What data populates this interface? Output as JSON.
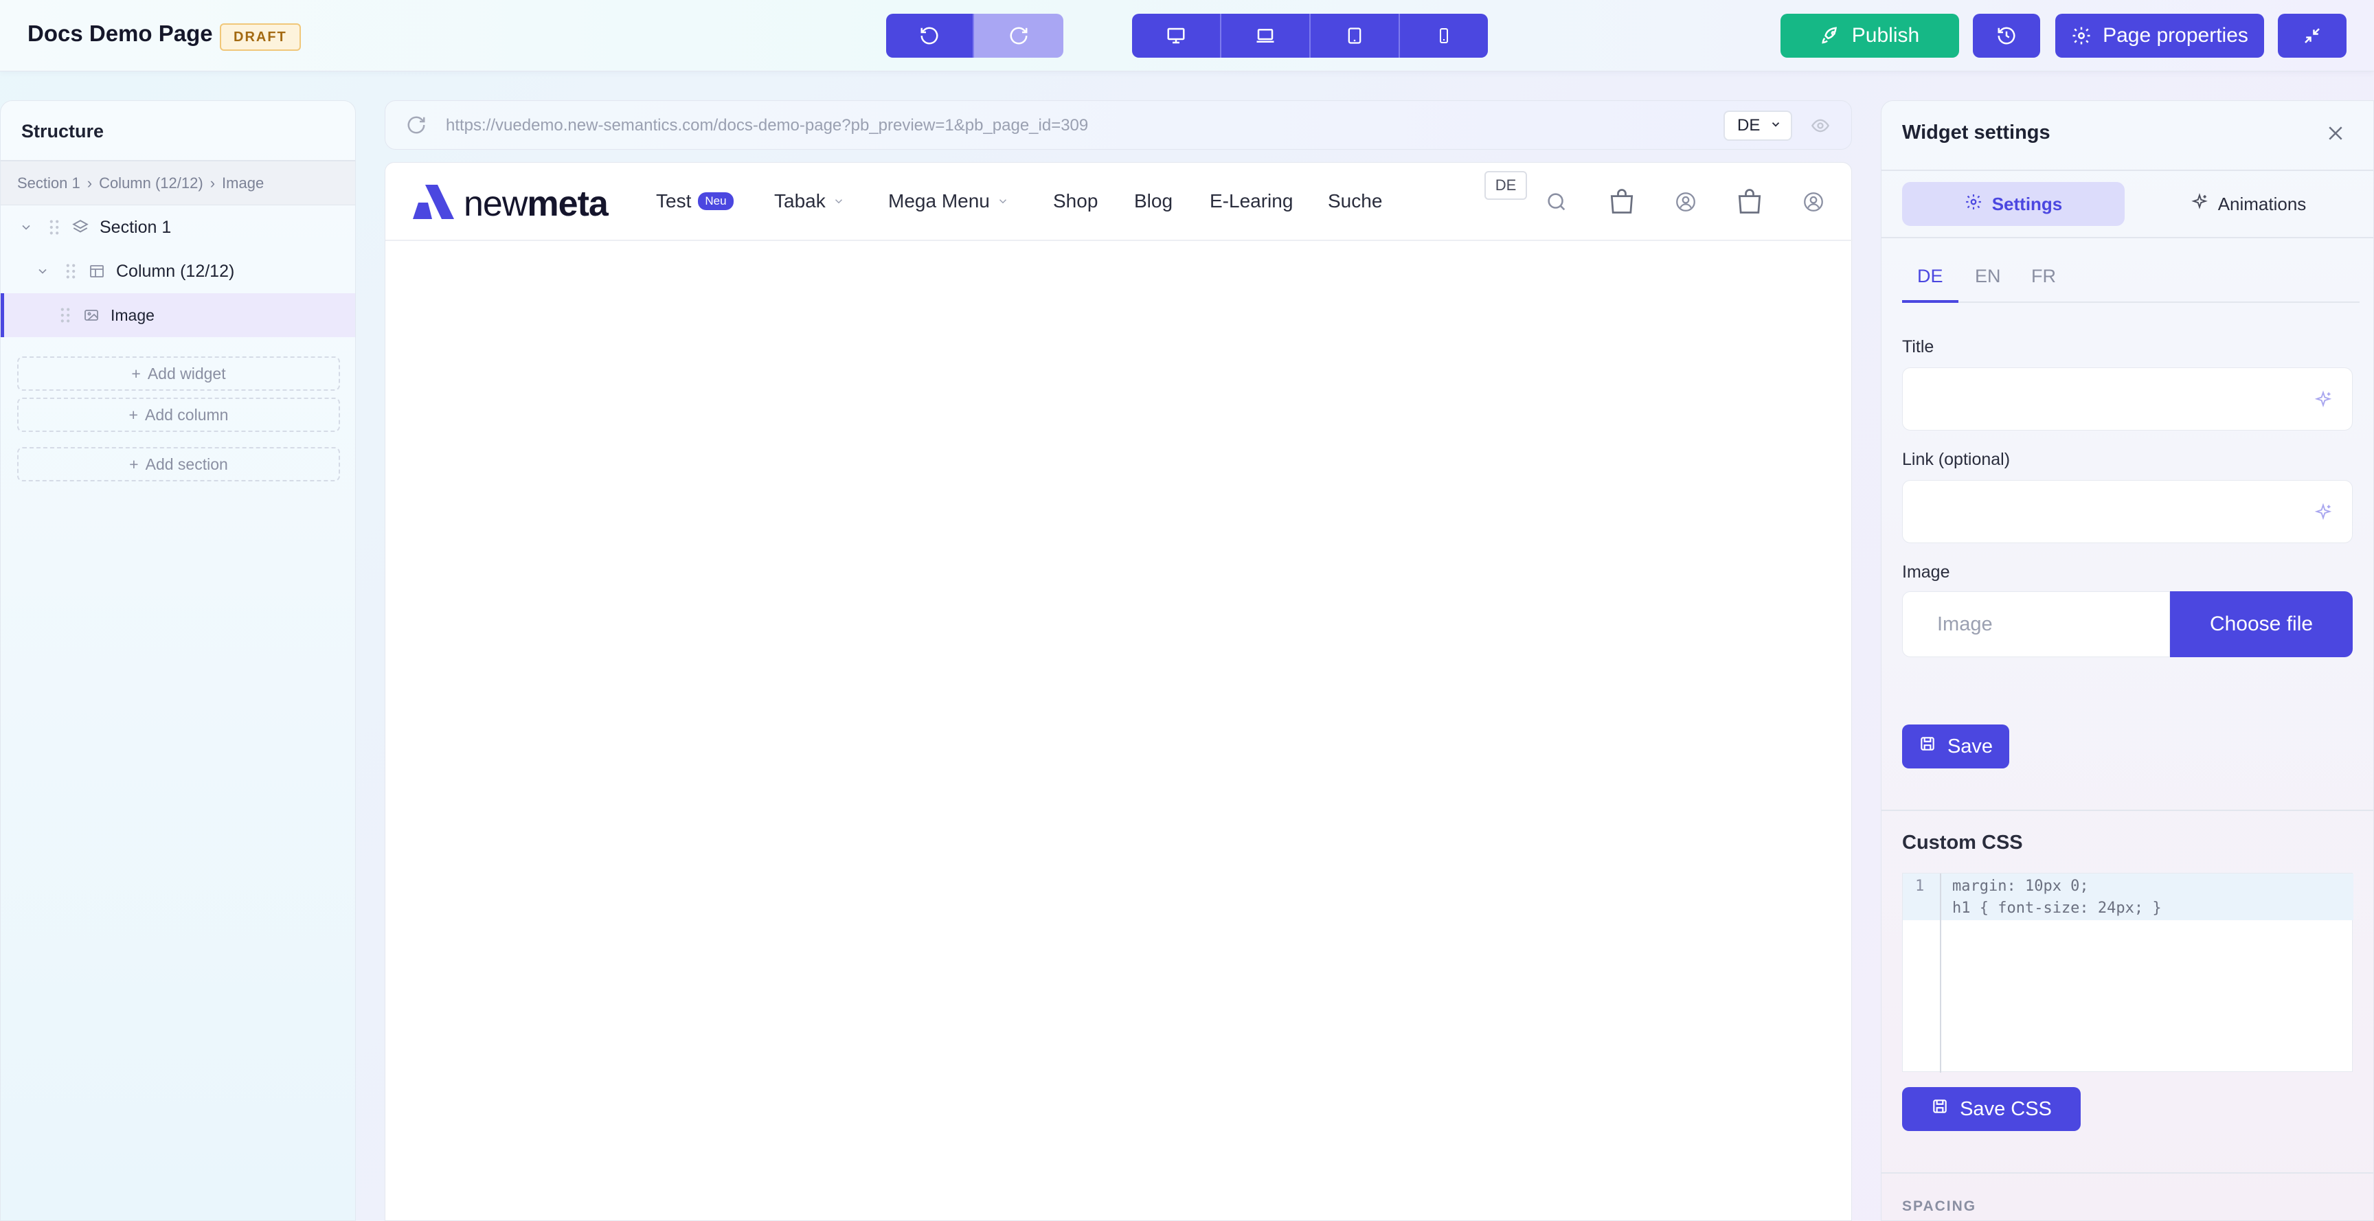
{
  "header": {
    "title": "Docs Demo Page",
    "badge": "DRAFT",
    "publish_label": "Publish",
    "page_properties_label": "Page properties",
    "colors": {
      "primary": "#4b47e0",
      "publish": "#16b886",
      "draft_bg": "#fdf3dc"
    }
  },
  "structure": {
    "title": "Structure",
    "breadcrumb": [
      "Section 1",
      "Column (12/12)",
      "Image"
    ],
    "tree": [
      {
        "label": "Section 1",
        "icon": "layers-icon"
      },
      {
        "label": "Column (12/12)",
        "icon": "layout-icon"
      },
      {
        "label": "Image",
        "icon": "image-icon"
      }
    ],
    "add_widget": "Add widget",
    "add_column": "Add column",
    "add_section": "Add section"
  },
  "preview": {
    "url": "https://vuedemo.new-semantics.com/docs-demo-page?pb_preview=1&pb_page_id=309",
    "language": "DE",
    "site": {
      "logo_light": "new",
      "logo_bold": "meta",
      "nav": [
        {
          "label": "Test",
          "badge": "Neu"
        },
        {
          "label": "Tabak",
          "dropdown": true
        },
        {
          "label": "Mega Menu",
          "dropdown": true
        },
        {
          "label": "Shop"
        },
        {
          "label": "Blog"
        },
        {
          "label": "E-Learing"
        },
        {
          "label": "Suche"
        }
      ],
      "lang_box": "DE"
    }
  },
  "widget_settings": {
    "title": "Widget settings",
    "tab_settings": "Settings",
    "tab_animations": "Animations",
    "languages": [
      "DE",
      "EN",
      "FR"
    ],
    "fields": {
      "title_label": "Title",
      "title_value": "",
      "link_label": "Link (optional)",
      "link_value": "",
      "image_label": "Image",
      "image_placeholder": "Image",
      "choose_file": "Choose file"
    },
    "save_label": "Save",
    "custom_css_title": "Custom CSS",
    "css_lines": [
      "margin: 10px 0;",
      "h1 { font-size: 24px; }"
    ],
    "line_number": "1",
    "save_css_label": "Save CSS",
    "spacing_label": "SPACING"
  }
}
